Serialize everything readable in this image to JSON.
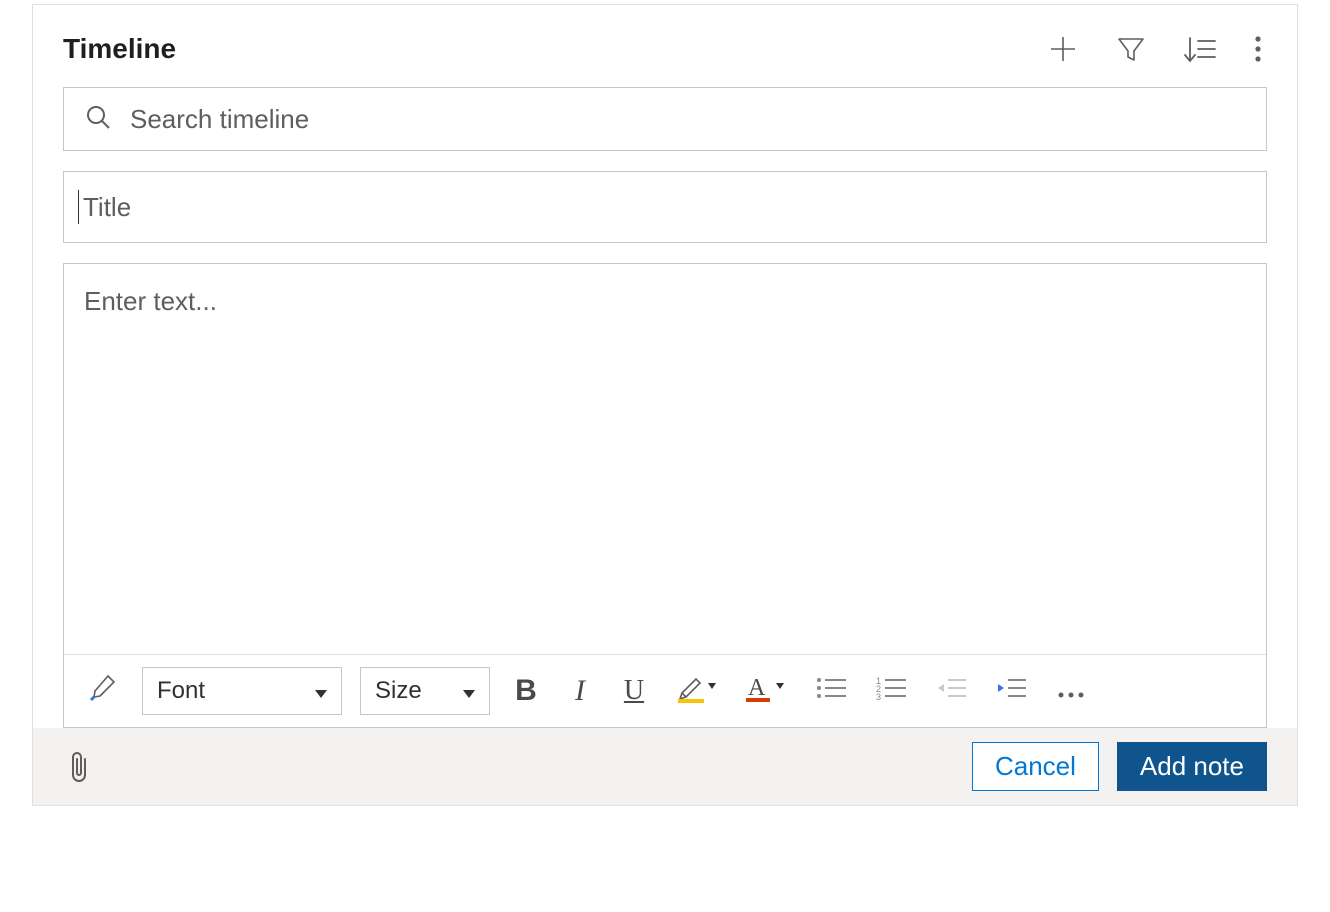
{
  "header": {
    "title": "Timeline"
  },
  "search": {
    "placeholder": "Search timeline",
    "value": ""
  },
  "note": {
    "title_placeholder": "Title",
    "title_value": "",
    "body_placeholder": "Enter text...",
    "body_value": ""
  },
  "toolbar": {
    "font_label": "Font",
    "size_label": "Size"
  },
  "footer": {
    "cancel_label": "Cancel",
    "add_note_label": "Add note"
  }
}
